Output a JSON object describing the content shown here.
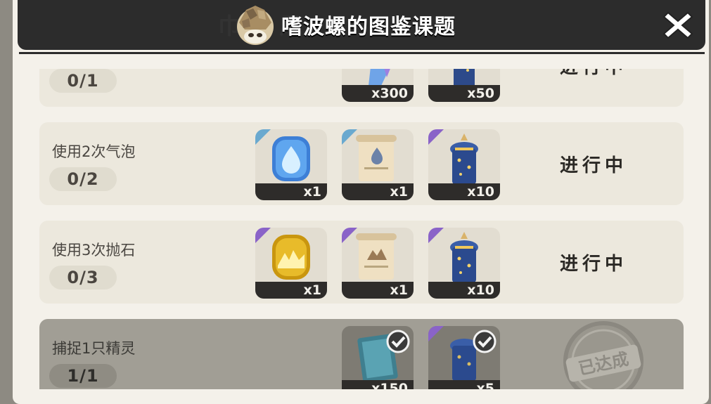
{
  "header": {
    "title": "嗜波螺的图鉴课题",
    "ghost_text": "巾山 风"
  },
  "colors": {
    "header_bg": "#2c2c2c",
    "panel_bg": "#f4f1ea",
    "row_bg": "#ece8dd",
    "row_done_bg": "#a19e95",
    "rarity_blue": "#6aa9cf",
    "rarity_purple": "#8a63c8"
  },
  "tasks": [
    {
      "label": "",
      "progress": "0/1",
      "status": "进行中",
      "rewards": [
        {
          "icon": "crystal-icon",
          "qty": "x300",
          "rarity": "none"
        },
        {
          "icon": "charm-pendant-icon",
          "qty": "x50",
          "rarity": "none"
        }
      ]
    },
    {
      "label": "使用2次气泡",
      "progress": "0/2",
      "status": "进行中",
      "rewards": [
        {
          "icon": "water-drop-badge-icon",
          "qty": "x1",
          "rarity": "blue"
        },
        {
          "icon": "scroll-icon",
          "qty": "x1",
          "rarity": "blue"
        },
        {
          "icon": "charm-pendant-icon",
          "qty": "x10",
          "rarity": "purple"
        }
      ]
    },
    {
      "label": "使用3次抛石",
      "progress": "0/3",
      "status": "进行中",
      "rewards": [
        {
          "icon": "rock-badge-icon",
          "qty": "x1",
          "rarity": "purple"
        },
        {
          "icon": "scroll-icon",
          "qty": "x1",
          "rarity": "purple"
        },
        {
          "icon": "charm-pendant-icon",
          "qty": "x10",
          "rarity": "purple"
        }
      ]
    },
    {
      "label": "捕捉1只精灵",
      "progress": "1/1",
      "status": "已达成",
      "rewards": [
        {
          "icon": "ticket-card-icon",
          "qty": "x150",
          "rarity": "none"
        },
        {
          "icon": "charm-pendant-icon",
          "qty": "x5",
          "rarity": "purple"
        }
      ]
    }
  ]
}
